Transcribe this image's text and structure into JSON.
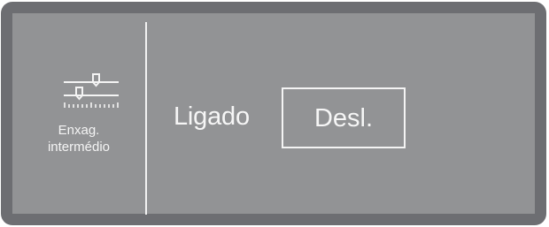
{
  "side_item": {
    "icon": "intermediate-rinse-slider-icon",
    "label_line1": "Enxag.",
    "label_line2": "intermédio"
  },
  "setting": {
    "label": "Ligado",
    "option_label": "Desl."
  },
  "colors": {
    "frame": "#6d6e72",
    "screen": "#929395",
    "foreground": "#f4f4f4"
  }
}
